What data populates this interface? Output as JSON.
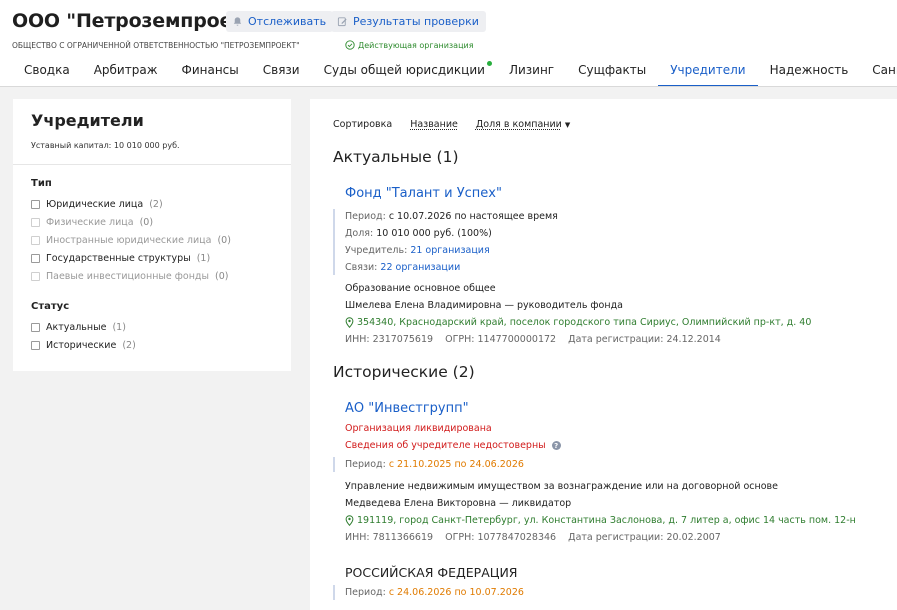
{
  "header": {
    "title": "ООО \"Петроземпроект\"",
    "follow_label": "Отслеживать",
    "results_label": "Результаты проверки",
    "subtitle": "ОБЩЕСТВО С ОГРАНИЧЕННОЙ ОТВЕТСТВЕННОСТЬЮ \"ПЕТРОЗЕМПРОЕКТ\"",
    "status": "Действующая организация"
  },
  "tabs": [
    {
      "label": "Сводка"
    },
    {
      "label": "Арбитраж"
    },
    {
      "label": "Финансы"
    },
    {
      "label": "Связи"
    },
    {
      "label": "Суды общей юрисдикции"
    },
    {
      "label": "Лизинг"
    },
    {
      "label": "Сущфакты"
    },
    {
      "label": "Учредители"
    },
    {
      "label": "Надежность"
    },
    {
      "label": "Санкции"
    }
  ],
  "filters": {
    "title": "Учредители",
    "capital": "Уставный капитал: 10 010 000 руб.",
    "type_label": "Тип",
    "type_items": [
      {
        "label": "Юридические лица",
        "count": "(2)"
      },
      {
        "label": "Физические лица",
        "count": "(0)"
      },
      {
        "label": "Иностранные юридические лица",
        "count": "(0)"
      },
      {
        "label": "Государственные структуры",
        "count": "(1)"
      },
      {
        "label": "Паевые инвестиционные фонды",
        "count": "(0)"
      }
    ],
    "status_label": "Статус",
    "status_items": [
      {
        "label": "Актуальные",
        "count": "(1)"
      },
      {
        "label": "Исторические",
        "count": "(2)"
      }
    ]
  },
  "sort": {
    "label": "Сортировка",
    "by_name": "Название",
    "by_share": "Доля в компании"
  },
  "actual": {
    "heading": "Актуальные (1)",
    "org": {
      "name": "Фонд \"Талант и Успех\"",
      "period_label": "Период:",
      "period": "с 10.07.2026 по настоящее время",
      "share_label": "Доля:",
      "share": "10 010 000 руб. (100%)",
      "founder_label": "Учредитель:",
      "founder": "21 организация",
      "links_label": "Связи:",
      "links": "22 организации",
      "activity": "Образование основное общее",
      "head": "Шмелева Елена Владимировна — руководитель фонда",
      "address": "354340, Краснодарский край, поселок городского типа Сириус, Олимпийский пр-кт, д. 40",
      "reqs": "ИНН: 2317075619    ОГРН: 1147700000172    Дата регистрации: 24.12.2014"
    }
  },
  "historical": {
    "heading": "Исторические (2)",
    "org1": {
      "name": "АО \"Инвестгрупп\"",
      "liquidated": "Организация ликвидирована",
      "unreliable": "Сведения об учредителе недостоверны",
      "period_label": "Период:",
      "period": "с 21.10.2025 по 24.06.2026",
      "activity": "Управление недвижимым имуществом за вознаграждение или на договорной основе",
      "head": "Медведева Елена Викторовна — ликвидатор",
      "address": "191119, город Санкт-Петербург, ул. Константина Заслонова, д. 7 литер а, офис 14 часть пом. 12-н",
      "reqs": "ИНН: 7811366619    ОГРН: 1077847028346    Дата регистрации: 20.02.2007"
    },
    "org2": {
      "name": "РОССИЙСКАЯ ФЕДЕРАЦИЯ",
      "period_label": "Период:",
      "period": "с 24.06.2026 по 10.07.2026"
    }
  },
  "colors": {
    "accent": "#1a5fc8",
    "active_status": "#2e8b2e",
    "alert": "#d11a1a",
    "period_orange": "#e07b00"
  }
}
